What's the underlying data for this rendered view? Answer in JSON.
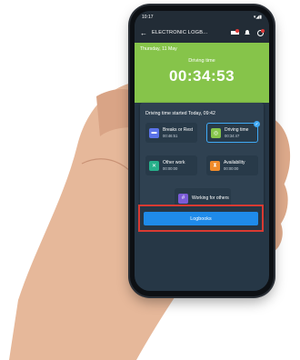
{
  "status_bar": {
    "time": "10:17"
  },
  "app_bar": {
    "title": "ELECTRONIC LOGB..."
  },
  "timer": {
    "date": "Thursday, 11 May",
    "label": "Driving time",
    "value": "00:34:53"
  },
  "card": {
    "started": "Driving time started Today, 09:42"
  },
  "activities": [
    {
      "name": "Breaks or Rest",
      "duration": "00:46:51",
      "color": "#5b73e8",
      "icon": "bed-icon"
    },
    {
      "name": "Driving time",
      "duration": "00:34:47",
      "color": "#86c44a",
      "icon": "steering-wheel-icon"
    },
    {
      "name": "Other work",
      "duration": "00:00:00",
      "color": "#27b08a",
      "icon": "tools-icon"
    },
    {
      "name": "Availability",
      "duration": "00:00:00",
      "color": "#f08b2a",
      "icon": "hourglass-icon"
    },
    {
      "name": "Working for others",
      "duration": "",
      "color": "#7a5bd6",
      "icon": "hash-icon"
    }
  ],
  "logbooks_button": {
    "label": "Logbooks"
  }
}
